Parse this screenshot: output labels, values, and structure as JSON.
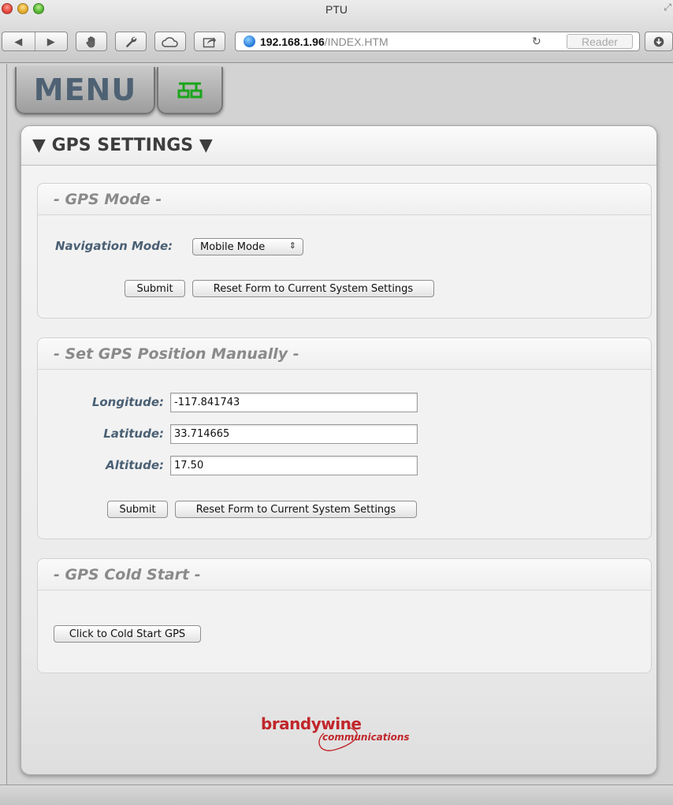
{
  "window": {
    "title": "PTU",
    "url_host": "192.168.1.96",
    "url_path": "/INDEX.HTM",
    "reader_label": "Reader"
  },
  "nav": {
    "menu_label": "MENU",
    "network_icon": "network-icon",
    "network_color": "#1aa51a"
  },
  "panel": {
    "title": "▼ GPS SETTINGS ▼"
  },
  "gps_mode": {
    "heading": "- GPS Mode -",
    "nav_mode_label": "Navigation Mode:",
    "nav_mode_value": "Mobile Mode",
    "submit_label": "Submit",
    "reset_label": "Reset Form to Current System Settings"
  },
  "manual_position": {
    "heading": "- Set GPS Position Manually -",
    "longitude_label": "Longitude:",
    "longitude_value": "-117.841743",
    "latitude_label": "Latitude:",
    "latitude_value": "33.714665",
    "altitude_label": "Altitude:",
    "altitude_value": "17.50",
    "submit_label": "Submit",
    "reset_label": "Reset Form to Current System Settings"
  },
  "cold_start": {
    "heading": "- GPS Cold Start -",
    "button_label": "Click to Cold Start GPS"
  },
  "footer": {
    "logo_main": "brandywine",
    "logo_sub": "communications",
    "logo_color": "#c0262b"
  }
}
